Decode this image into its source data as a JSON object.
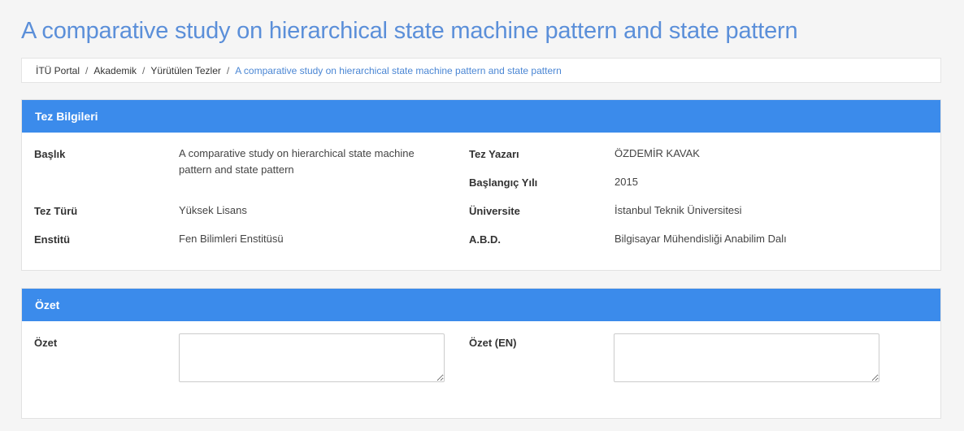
{
  "page": {
    "title": "A comparative study on hierarchical state machine pattern and state pattern"
  },
  "breadcrumb": {
    "items": [
      "İTÜ Portal",
      "Akademik",
      "Yürütülen Tezler"
    ],
    "current": "A comparative study on hierarchical state machine pattern and state pattern"
  },
  "thesis_info": {
    "heading": "Tez Bilgileri",
    "title_label": "Başlık",
    "title_value": "A comparative study on hierarchical state machine pattern and state pattern",
    "author_label": "Tez Yazarı",
    "author_value": "ÖZDEMİR KAVAK",
    "start_year_label": "Başlangıç Yılı",
    "start_year_value": "2015",
    "type_label": "Tez Türü",
    "type_value": "Yüksek Lisans",
    "university_label": "Üniversite",
    "university_value": "İstanbul Teknik Üniversitesi",
    "institute_label": "Enstitü",
    "institute_value": "Fen Bilimleri Enstitüsü",
    "department_label": "A.B.D.",
    "department_value": "Bilgisayar Mühendisliği Anabilim Dalı"
  },
  "summary": {
    "heading": "Özet",
    "abstract_label": "Özet",
    "abstract_value": "",
    "abstract_en_label": "Özet (EN)",
    "abstract_en_value": ""
  },
  "colors": {
    "title": "#5b8fd9",
    "panel_heading": "#3b8beb",
    "breadcrumb_current": "#4a86d4",
    "background": "#f5f5f5"
  }
}
